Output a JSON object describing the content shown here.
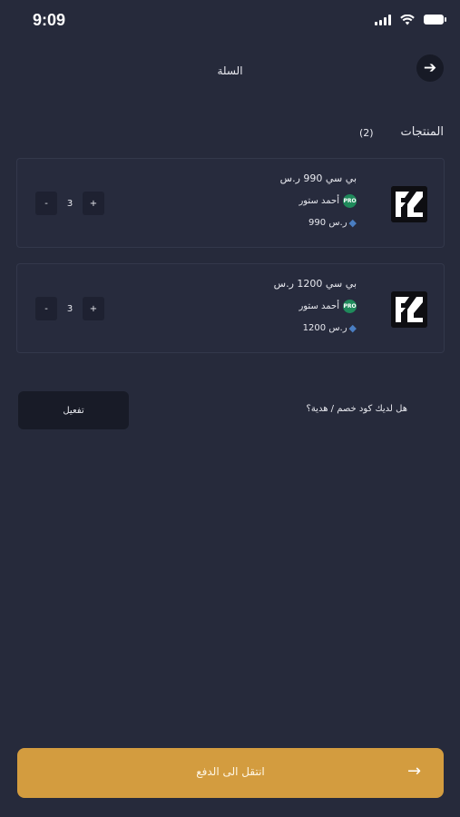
{
  "status_bar": {
    "time": "9:09"
  },
  "header": {
    "title": "السلة"
  },
  "section": {
    "title": "المنتجات",
    "count": "(2)"
  },
  "products": [
    {
      "name": "بي سي 990 ر.س",
      "store": "أحمد ستور",
      "store_badge": "PRO",
      "price": "990 ر.س",
      "quantity": "3"
    },
    {
      "name": "بي سي 1200 ر.س",
      "store": "أحمد ستور",
      "store_badge": "PRO",
      "price": "1200 ر.س",
      "quantity": "3"
    }
  ],
  "qty_controls": {
    "minus": "-",
    "plus": "+"
  },
  "coupon": {
    "button_label": "تفعيل",
    "question": "هل لديك كود خصم / هدية؟"
  },
  "checkout": {
    "label": "انتقل الى الدفع",
    "arrow": "→"
  },
  "colors": {
    "background": "#262a3b",
    "accent": "#d39c3f",
    "card": "#272b3d"
  }
}
